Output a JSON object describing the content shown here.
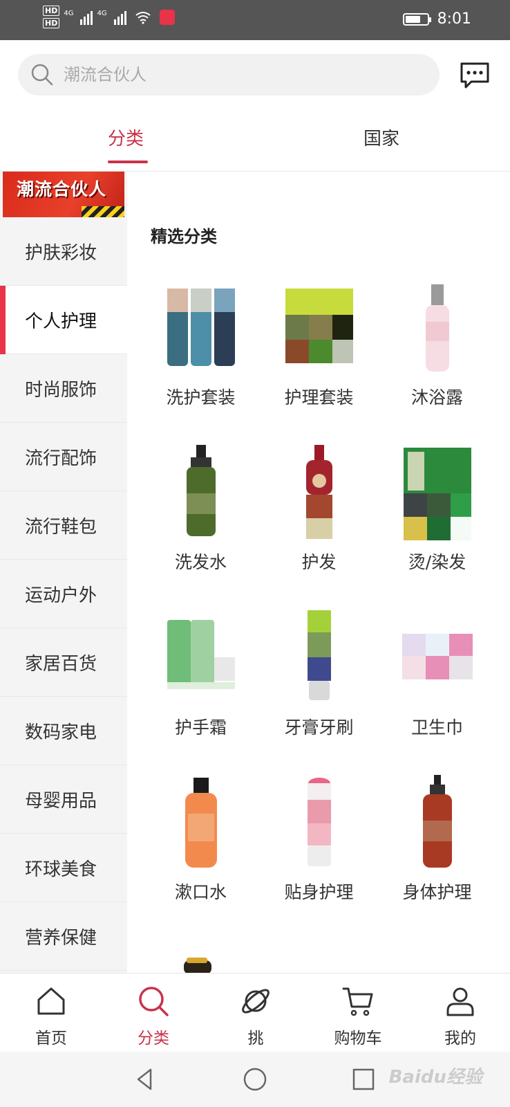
{
  "status_bar": {
    "time": "8:01",
    "hd_labels": [
      "HD",
      "HD"
    ],
    "network_labels": [
      "4G",
      "4G"
    ],
    "battery_level": 0.7
  },
  "search": {
    "placeholder": "潮流合伙人"
  },
  "top_tabs": [
    {
      "label": "分类",
      "active": true
    },
    {
      "label": "国家",
      "active": false
    }
  ],
  "sidebar": {
    "banner_text": "潮流合伙人",
    "items": [
      {
        "label": "护肤彩妆"
      },
      {
        "label": "个人护理",
        "active": true
      },
      {
        "label": "时尚服饰"
      },
      {
        "label": "流行配饰"
      },
      {
        "label": "流行鞋包"
      },
      {
        "label": "运动户外"
      },
      {
        "label": "家居百货"
      },
      {
        "label": "数码家电"
      },
      {
        "label": "母婴用品"
      },
      {
        "label": "环球美食"
      },
      {
        "label": "营养保健"
      }
    ]
  },
  "section_title": "精选分类",
  "categories": [
    {
      "label": "洗护套装",
      "icon": "wash-set-product-image"
    },
    {
      "label": "护理套装",
      "icon": "care-set-product-image"
    },
    {
      "label": "沐浴露",
      "icon": "body-wash-product-image"
    },
    {
      "label": "洗发水",
      "icon": "shampoo-product-image"
    },
    {
      "label": "护发",
      "icon": "hair-care-product-image"
    },
    {
      "label": "烫/染发",
      "icon": "hair-dye-product-image"
    },
    {
      "label": "护手霜",
      "icon": "hand-cream-product-image"
    },
    {
      "label": "牙膏牙刷",
      "icon": "toothpaste-product-image"
    },
    {
      "label": "卫生巾",
      "icon": "sanitary-pad-product-image"
    },
    {
      "label": "漱口水",
      "icon": "mouthwash-product-image"
    },
    {
      "label": "贴身护理",
      "icon": "intimate-care-product-image"
    },
    {
      "label": "身体护理",
      "icon": "body-care-product-image"
    }
  ],
  "bottom_nav": [
    {
      "label": "首页",
      "icon": "home-icon"
    },
    {
      "label": "分类",
      "icon": "search-icon",
      "active": true
    },
    {
      "label": "挑",
      "icon": "planet-icon"
    },
    {
      "label": "购物车",
      "icon": "cart-icon"
    },
    {
      "label": "我的",
      "icon": "user-icon"
    }
  ],
  "watermark": "Baidu经验",
  "colors": {
    "accent": "#c8334a",
    "active_bar": "#e8334a",
    "status_bar": "#555555",
    "sidebar_bg": "#f4f4f4"
  }
}
